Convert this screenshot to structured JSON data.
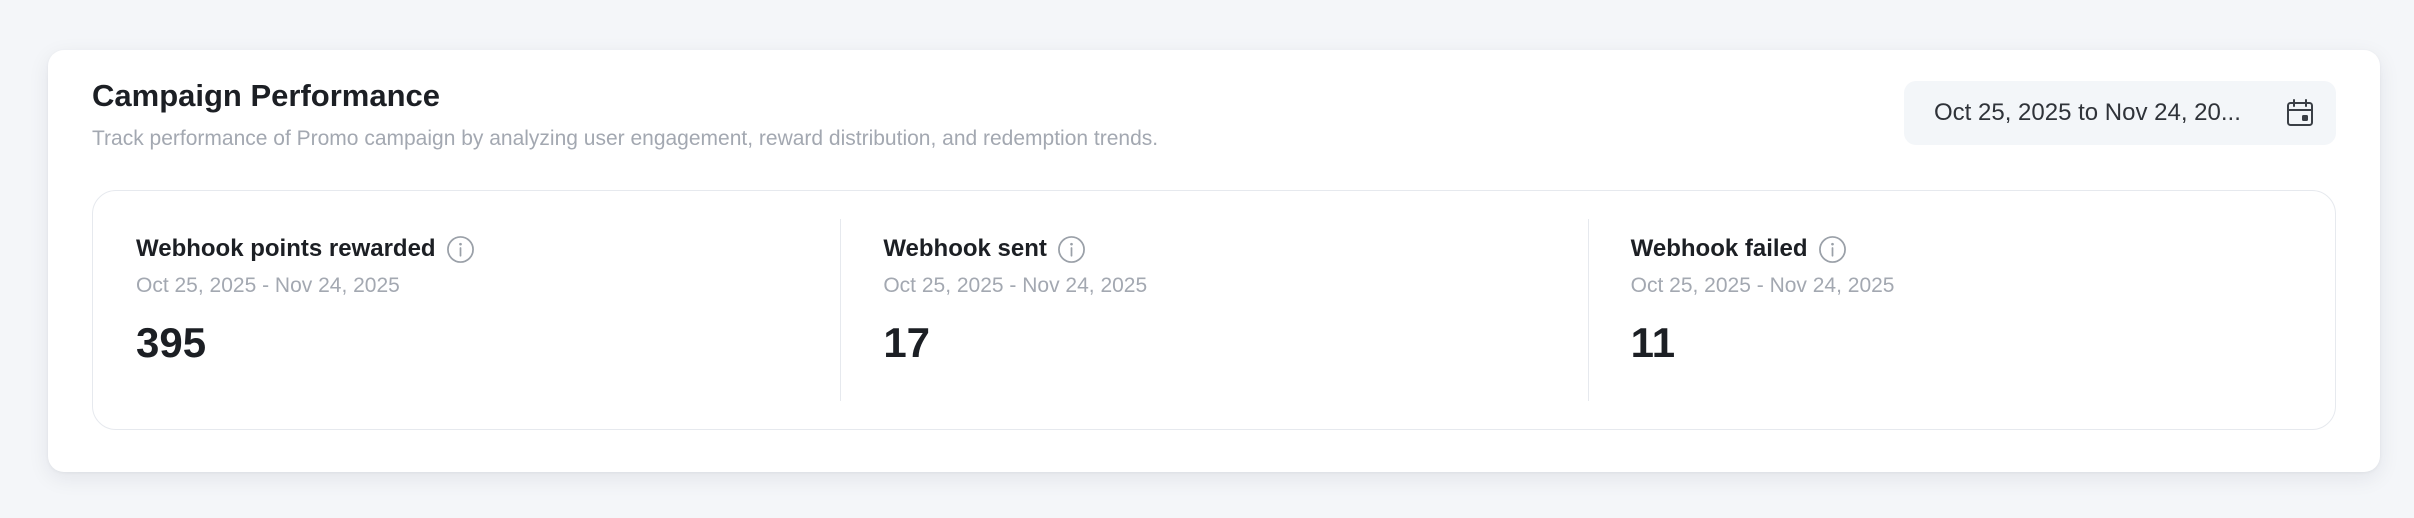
{
  "header": {
    "title": "Campaign Performance",
    "subtitle": "Track performance of Promo campaign by analyzing user engagement, reward distribution, and redemption trends."
  },
  "date_range": {
    "display": "Oct 25, 2025 to Nov 24, 20...",
    "icon": "calendar-icon"
  },
  "stats": [
    {
      "label": "Webhook points rewarded",
      "range": "Oct 25, 2025 - Nov 24, 2025",
      "value": "395",
      "icon": "info-icon"
    },
    {
      "label": "Webhook sent",
      "range": "Oct 25, 2025 - Nov 24, 2025",
      "value": "17",
      "icon": "info-icon"
    },
    {
      "label": "Webhook failed",
      "range": "Oct 25, 2025 - Nov 24, 2025",
      "value": "11",
      "icon": "info-icon"
    }
  ],
  "colors": {
    "page_background": "#f4f6f9",
    "card_background": "#ffffff",
    "primary_text": "#1c1f24",
    "muted_text": "#a3a8b1",
    "border": "#e6e9ee",
    "date_picker_background": "#f3f6f9"
  }
}
